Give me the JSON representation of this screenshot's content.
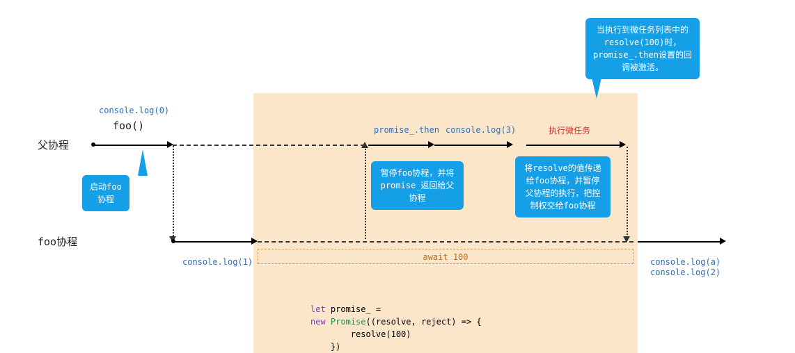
{
  "labels": {
    "parent": "父协程",
    "foo": "foo协程"
  },
  "top_timeline": {
    "log0": "console.log(0)",
    "foo_call": "foo()",
    "promise_then": "promise_.then",
    "log3": "console.log(3)",
    "microtask": "执行微任务"
  },
  "foo_timeline": {
    "log1": "console.log(1)",
    "await_label": "await 100",
    "loga": "console.log(a)",
    "log2": "console.log(2)"
  },
  "callouts": {
    "start": "启动foo协程",
    "pause": "暂停foo协程，并将promise_返回给父协程",
    "resolve_pass": "将resolve的值传递给foo协程，并暂停父协程的执行，把控制权交给foo协程",
    "top": "当执行到微任务列表中的resolve(100)时，promise_.then设置的回调被激活。"
  },
  "code_block": {
    "l1_a": "let",
    "l1_b": " promise_ =",
    "l2_a": "new ",
    "l2_b": "Promise",
    "l2_c": "((resolve, reject) => {",
    "l3": "        resolve(100)",
    "l4": "    })"
  }
}
